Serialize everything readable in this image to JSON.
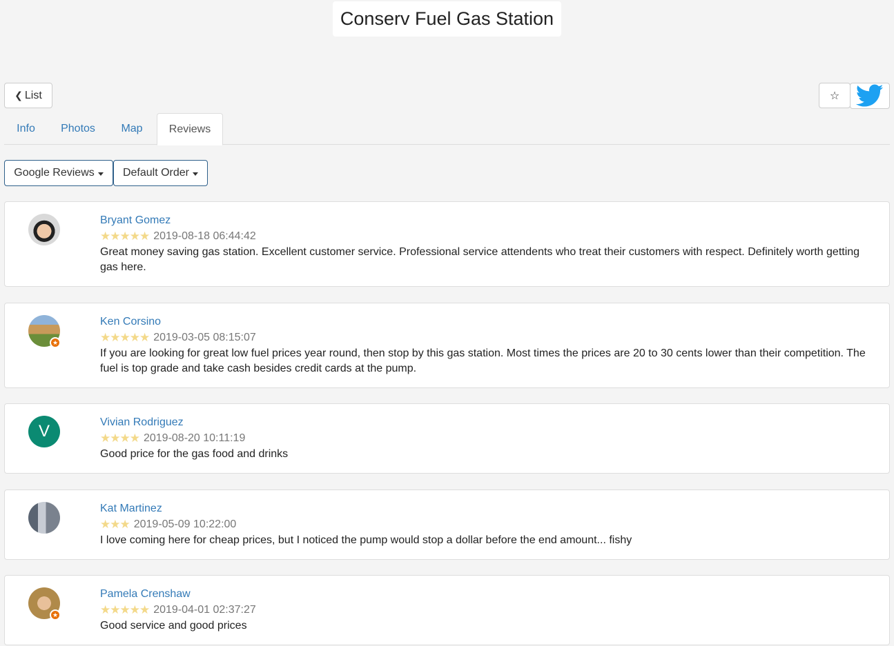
{
  "page": {
    "title": "Conserv Fuel Gas Station"
  },
  "toolbar": {
    "list_label": "List",
    "favorite_icon": "star-outline-icon",
    "twitter_icon": "twitter-bird-icon"
  },
  "tabs": [
    {
      "label": "Info",
      "active": false
    },
    {
      "label": "Photos",
      "active": false
    },
    {
      "label": "Map",
      "active": false
    },
    {
      "label": "Reviews",
      "active": true
    }
  ],
  "filters": {
    "source_label": "Google Reviews",
    "order_label": "Default Order"
  },
  "colors": {
    "link": "#337ab7",
    "star": "#f3d98a",
    "badge": "#e8710a",
    "twitter": "#1da1f2"
  },
  "reviews": [
    {
      "author": "Bryant Gomez",
      "stars": "★★★★★",
      "rating": 5,
      "date": "2019-08-18 06:44:42",
      "text": "Great money saving gas station. Excellent customer service. Professional service attendents who treat their customers with respect. Definitely worth getting gas here."
    },
    {
      "author": "Ken Corsino",
      "stars": "★★★★★",
      "rating": 5,
      "date": "2019-03-05 08:15:07",
      "text": "If you are looking for great low fuel prices year round, then stop by this gas station. Most times the prices are 20 to 30 cents lower than their competition. The fuel is top grade and take cash besides credit cards at the pump."
    },
    {
      "author": "Vivian Rodriguez",
      "avatar_letter": "V",
      "stars": "★★★★",
      "rating": 4,
      "date": "2019-08-20 10:11:19",
      "text": "Good price for the gas food and drinks"
    },
    {
      "author": "Kat Martinez",
      "stars": "★★★",
      "rating": 3,
      "date": "2019-05-09 10:22:00",
      "text": "I love coming here for cheap prices, but I noticed the pump would stop a dollar before the end amount... fishy"
    },
    {
      "author": "Pamela Crenshaw",
      "stars": "★★★★★",
      "rating": 5,
      "date": "2019-04-01 02:37:27",
      "text": "Good service and good prices"
    }
  ]
}
